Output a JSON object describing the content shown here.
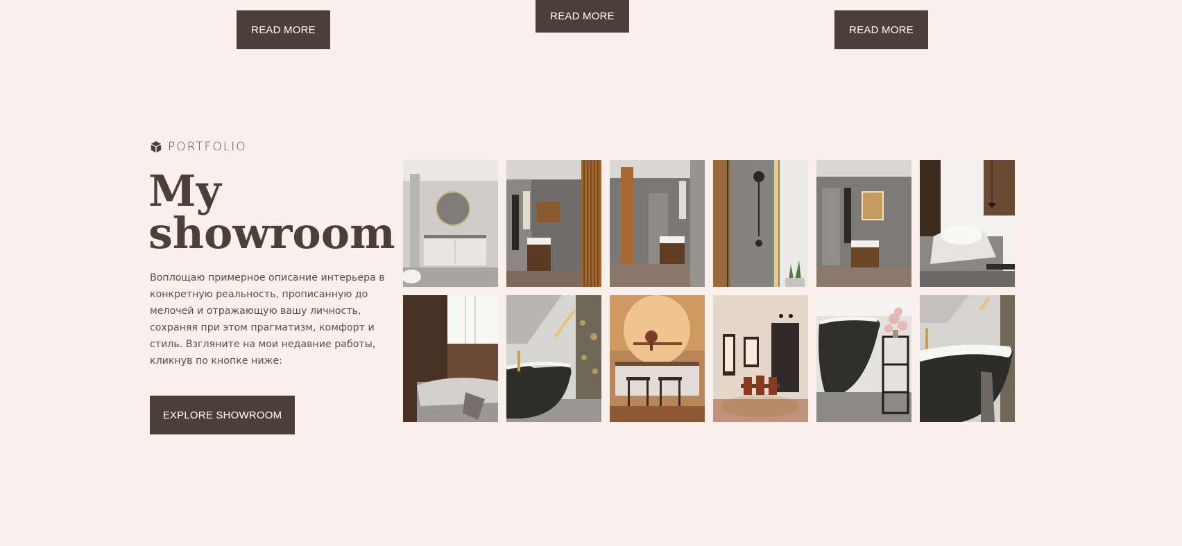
{
  "top_buttons": [
    "READ MORE",
    "READ MORE",
    "READ MORE"
  ],
  "portfolio": {
    "eyebrow": "PORTFOLIO",
    "eyebrow_icon": "box-icon",
    "title_line1": "My",
    "title_line2": "showroom",
    "description": "Воплощаю примерное описание интерьера в конкретную реальность, прописанную до мелочей и отражающую вашу личность, сохраняя при этом прагматизм, комфорт и стиль. Взгляните на мои недавние работы, кликнув по кнопке ниже:",
    "explore_label": "EXPLORE SHOWROOM"
  },
  "colors": {
    "background": "#f9f0eb",
    "button": "#4b3f37",
    "text": "#4b3f37"
  }
}
